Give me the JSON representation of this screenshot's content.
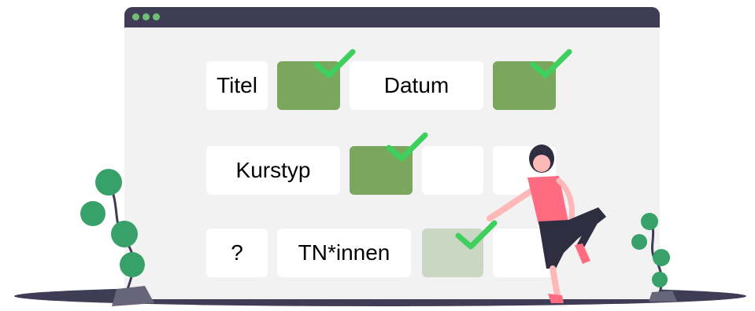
{
  "colors": {
    "window_bg": "#f2f2f2",
    "titlebar": "#3f3d56",
    "traffic_light": "#6fbf73",
    "cell_bg": "#ffffff",
    "checked_box": "#7aa65e",
    "checked_box_faded": "#cad8c3",
    "checkmark": "#3ecf5c",
    "plant_leaf": "#37a169",
    "person_shirt": "#ff6b81",
    "person_pants": "#2f2e41"
  },
  "window": {
    "traffic_lights": [
      "dot",
      "dot",
      "dot"
    ]
  },
  "form": {
    "row1": {
      "label_a": "Titel",
      "label_b": "Datum"
    },
    "row2": {
      "label_a": "Kurstyp"
    },
    "row3": {
      "label_a": "?",
      "label_b": "TN*innen"
    }
  },
  "checkboxes": [
    {
      "row": 1,
      "checked": true
    },
    {
      "row": 1,
      "checked": true
    },
    {
      "row": 2,
      "checked": true
    },
    {
      "row": 2,
      "checked": false
    },
    {
      "row": 2,
      "checked": false
    },
    {
      "row": 3,
      "checked": true,
      "faded": true
    },
    {
      "row": 3,
      "checked": false
    }
  ],
  "icons": [
    "checkmark-icon",
    "plant-icon",
    "person-illustration"
  ]
}
